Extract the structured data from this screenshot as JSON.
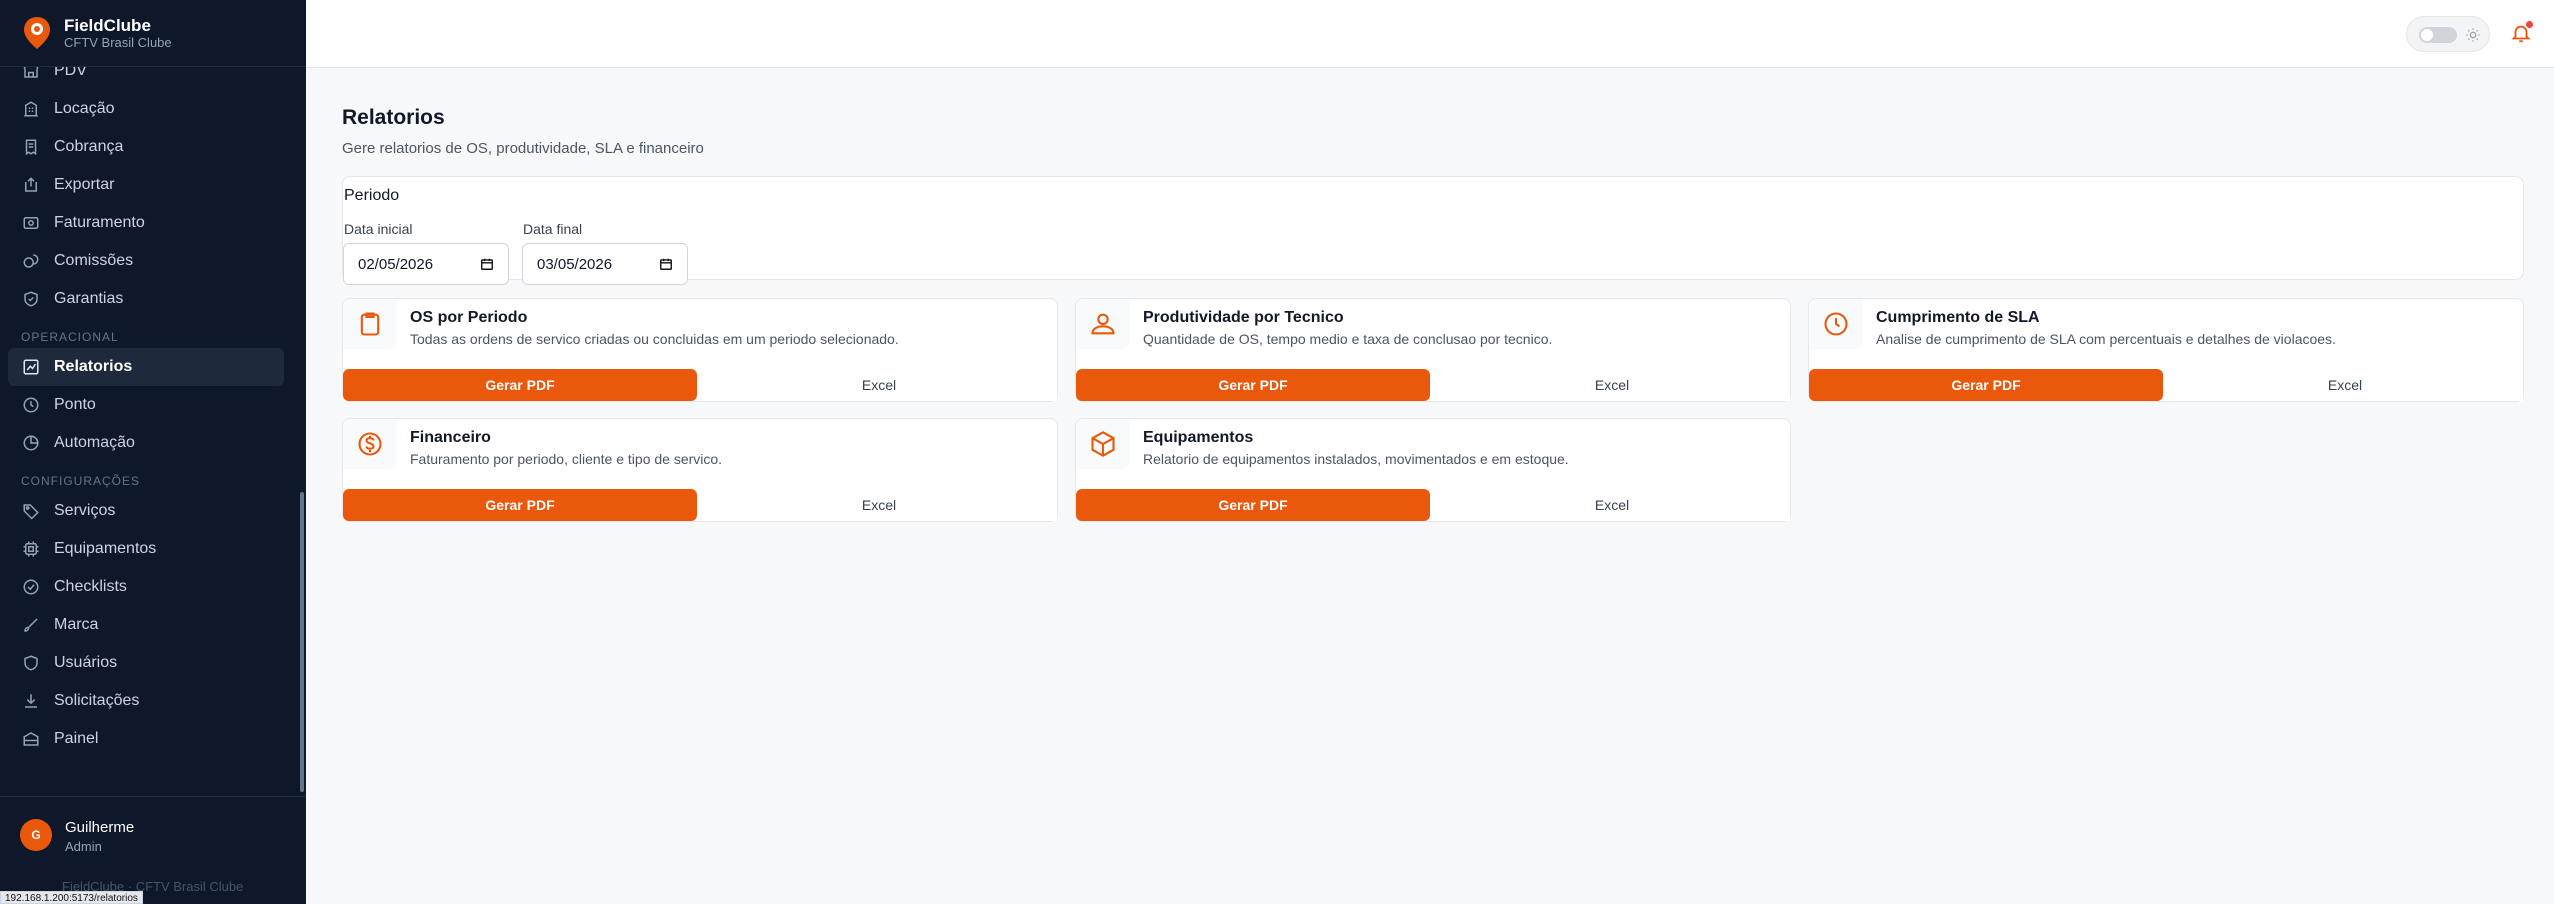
{
  "brand": {
    "name": "FieldClube",
    "subtitle": "CFTV Brasil Clube"
  },
  "sidebar": {
    "items_top": [
      {
        "label": "PDV",
        "icon": "store-icon"
      },
      {
        "label": "Locação",
        "icon": "building-icon"
      },
      {
        "label": "Cobrança",
        "icon": "receipt-icon"
      },
      {
        "label": "Exportar",
        "icon": "export-icon"
      },
      {
        "label": "Faturamento",
        "icon": "invoice-icon"
      },
      {
        "label": "Comissões",
        "icon": "coins-icon"
      },
      {
        "label": "Garantias",
        "icon": "shield-check-icon"
      }
    ],
    "section_operacional": "OPERACIONAL",
    "items_operacional": [
      {
        "label": "Relatorios",
        "icon": "chart-icon",
        "active": true
      },
      {
        "label": "Ponto",
        "icon": "clock-icon"
      },
      {
        "label": "Automação",
        "icon": "zap-icon"
      }
    ],
    "section_config": "CONFIGURAÇÕES",
    "items_config": [
      {
        "label": "Serviços",
        "icon": "tag-icon"
      },
      {
        "label": "Equipamentos",
        "icon": "cpu-icon"
      },
      {
        "label": "Checklists",
        "icon": "check-circle-icon"
      },
      {
        "label": "Marca",
        "icon": "brush-icon"
      },
      {
        "label": "Usuários",
        "icon": "shield-icon"
      },
      {
        "label": "Solicitações",
        "icon": "download-icon"
      },
      {
        "label": "Painel",
        "icon": "panel-icon"
      }
    ]
  },
  "user": {
    "initial": "G",
    "name": "Guilherme",
    "role": "Admin",
    "footer": "FieldClube · CFTV Brasil Clube"
  },
  "status_url": "192.168.1.200:5173/relatorios",
  "page": {
    "title": "Relatorios",
    "subtitle": "Gere relatorios de OS, produtividade, SLA e financeiro"
  },
  "period": {
    "title": "Periodo",
    "start_label": "Data inicial",
    "start_value": "02/05/2026",
    "end_label": "Data final",
    "end_value": "03/05/2026"
  },
  "reports": [
    {
      "title": "OS por Periodo",
      "desc": "Todas as ordens de servico criadas ou concluidas em um periodo selecionado.",
      "icon": "clipboard-icon",
      "pdf": "Gerar PDF",
      "excel": "Excel"
    },
    {
      "title": "Produtividade por Tecnico",
      "desc": "Quantidade de OS, tempo medio e taxa de conclusao por tecnico.",
      "icon": "users-icon",
      "pdf": "Gerar PDF",
      "excel": "Excel"
    },
    {
      "title": "Cumprimento de SLA",
      "desc": "Analise de cumprimento de SLA com percentuais e detalhes de violacoes.",
      "icon": "clock-icon",
      "pdf": "Gerar PDF",
      "excel": "Excel"
    },
    {
      "title": "Financeiro",
      "desc": "Faturamento por periodo, cliente e tipo de servico.",
      "icon": "dollar-icon",
      "pdf": "Gerar PDF",
      "excel": "Excel"
    },
    {
      "title": "Equipamentos",
      "desc": "Relatorio de equipamentos instalados, movimentados e em estoque.",
      "icon": "box-icon",
      "pdf": "Gerar PDF",
      "excel": "Excel"
    }
  ],
  "colors": {
    "accent": "#ea580c",
    "sidebar_bg": "#0f172a",
    "page_bg": "#f7f8fa"
  }
}
